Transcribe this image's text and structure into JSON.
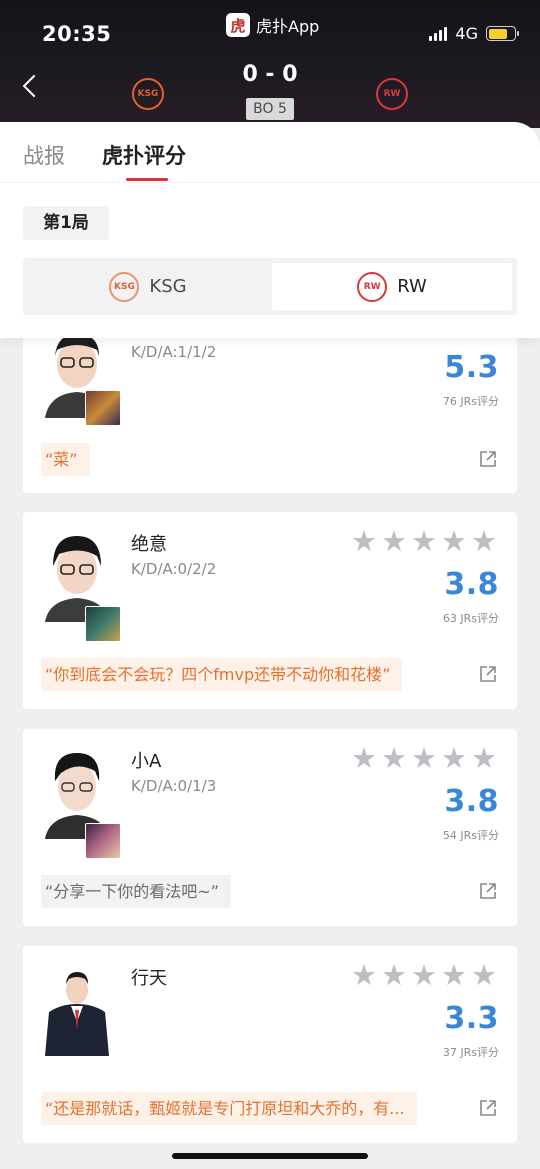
{
  "status": {
    "time": "20:35",
    "app": "虎扑App",
    "network": "4G"
  },
  "match": {
    "score": "0 - 0",
    "format": "BO 5",
    "home_logo": "KSG",
    "away_logo": "RW"
  },
  "tabs": [
    {
      "label": "战报"
    },
    {
      "label": "虎扑评分"
    }
  ],
  "game_label": "第1局",
  "teams": [
    {
      "name": "KSG",
      "logo": "KSG"
    },
    {
      "name": "RW",
      "logo": "RW"
    }
  ],
  "players": [
    {
      "name": "",
      "kda": "K/D/A:1/1/2",
      "rating": "5.3",
      "votes": "76 JRs评分",
      "quote": "“菜”"
    },
    {
      "name": "绝意",
      "kda": "K/D/A:0/2/2",
      "rating": "3.8",
      "votes": "63 JRs评分",
      "quote": "“你到底会不会玩？四个fmvp还带不动你和花楼”"
    },
    {
      "name": "小A",
      "kda": "K/D/A:0/1/3",
      "rating": "3.8",
      "votes": "54 JRs评分",
      "quote": "“分享一下你的看法吧~”"
    },
    {
      "name": "行天",
      "kda": "",
      "rating": "3.3",
      "votes": "37 JRs评分",
      "quote": "“还是那就话，甄姬就是专门打原坦和大乔的，有..."
    }
  ],
  "colors": {
    "accent": "#d8362f",
    "rating": "#3a86d8",
    "quote_hot": "#e8702c"
  },
  "icons": [
    "back-icon",
    "share-icon",
    "star-icon",
    "signal-icon",
    "battery-icon"
  ]
}
